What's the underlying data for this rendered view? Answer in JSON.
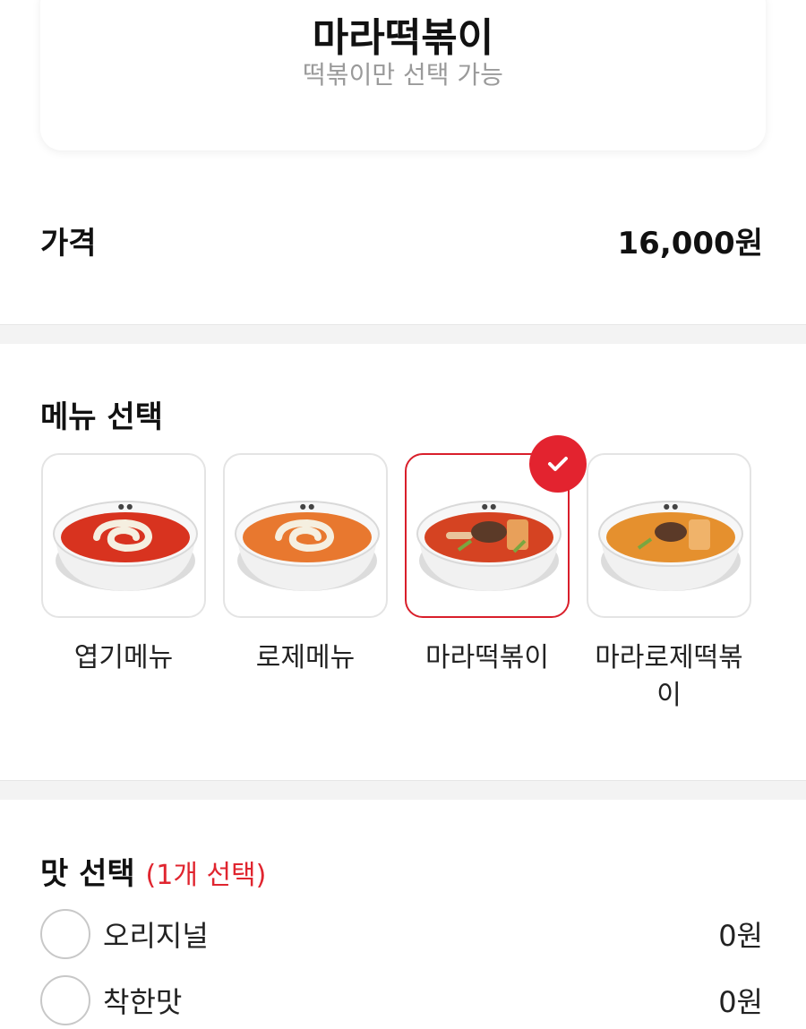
{
  "product": {
    "title": "마라떡볶이",
    "subtitle": "떡볶이만 선택 가능"
  },
  "price": {
    "label": "가격",
    "value": "16,000원"
  },
  "menu_section": {
    "title": "메뉴 선택",
    "items": [
      {
        "name": "엽기메뉴",
        "selected": false,
        "sauce_color": "#d8331f",
        "topping": "cream-swirl"
      },
      {
        "name": "로제메뉴",
        "selected": false,
        "sauce_color": "#e8782f",
        "topping": "cream-swirl"
      },
      {
        "name": "마라떡볶이",
        "selected": true,
        "sauce_color": "#d54322",
        "topping": "beef"
      },
      {
        "name": "마라로제떡볶이",
        "selected": false,
        "sauce_color": "#e5902e",
        "topping": "beef"
      }
    ]
  },
  "flavor_section": {
    "title": "맛 선택",
    "hint": "(1개 선택)",
    "options": [
      {
        "label": "오리지널",
        "price": "0원"
      },
      {
        "label": "착한맛",
        "price": "0원"
      }
    ]
  },
  "colors": {
    "accent": "#e3232f",
    "muted_text": "#9a9a9a",
    "divider": "#f3f3f3"
  }
}
